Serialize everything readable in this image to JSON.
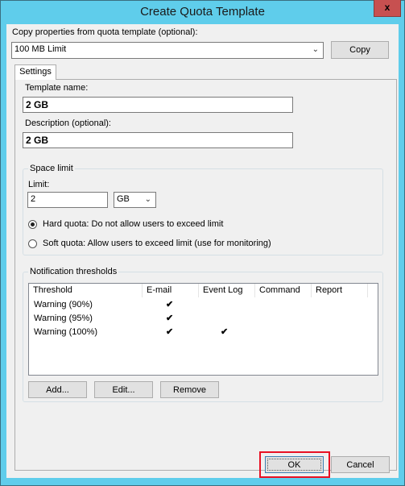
{
  "window": {
    "title": "Create Quota Template",
    "close_glyph": "x"
  },
  "copy_from": {
    "label": "Copy properties from quota template (optional):",
    "selected": "100 MB Limit",
    "copy_button": "Copy"
  },
  "tabs": [
    {
      "label": "Settings",
      "active": true
    }
  ],
  "template_name": {
    "label": "Template name:",
    "value": "2 GB"
  },
  "description": {
    "label": "Description (optional):",
    "value": "2 GB"
  },
  "space_limit": {
    "group_title": "Space limit",
    "limit_label": "Limit:",
    "limit_value": "2",
    "unit_selected": "GB",
    "hard_quota_label": "Hard quota: Do not allow users to exceed limit",
    "hard_quota_selected": true,
    "soft_quota_label": "Soft quota: Allow users to exceed limit (use for monitoring)",
    "soft_quota_selected": false
  },
  "notifications": {
    "group_title": "Notification thresholds",
    "columns": [
      "Threshold",
      "E-mail",
      "Event Log",
      "Command",
      "Report"
    ],
    "rows": [
      {
        "threshold": "Warning (90%)",
        "email": "✔",
        "event_log": "",
        "command": "",
        "report": ""
      },
      {
        "threshold": "Warning (95%)",
        "email": "✔",
        "event_log": "",
        "command": "",
        "report": ""
      },
      {
        "threshold": "Warning (100%)",
        "email": "✔",
        "event_log": "✔",
        "command": "",
        "report": ""
      }
    ],
    "add_button": "Add...",
    "edit_button": "Edit...",
    "remove_button": "Remove"
  },
  "footer": {
    "ok_button": "OK",
    "cancel_button": "Cancel",
    "highlight_color": "#e81123"
  }
}
